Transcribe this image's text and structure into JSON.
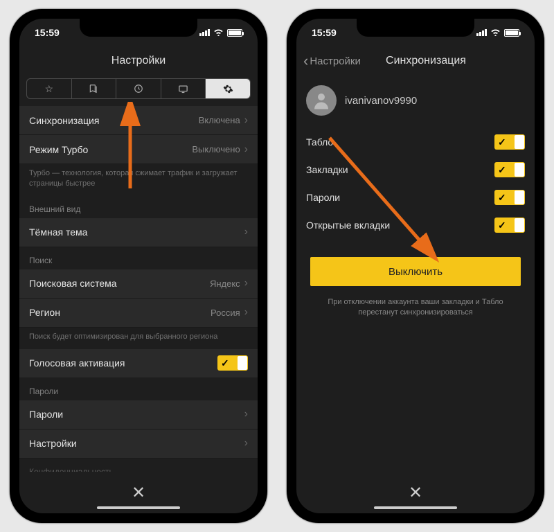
{
  "status": {
    "time": "15:59"
  },
  "left": {
    "title": "Настройки",
    "rows": {
      "sync": {
        "label": "Синхронизация",
        "value": "Включена"
      },
      "turbo": {
        "label": "Режим Турбо",
        "value": "Выключено"
      },
      "turbo_hint": "Турбо — технология, которая сжимает трафик и загружает страницы быстрее",
      "theme": {
        "label": "Тёмная тема"
      },
      "search_engine": {
        "label": "Поисковая система",
        "value": "Яндекс"
      },
      "region": {
        "label": "Регион",
        "value": "Россия"
      },
      "region_hint": "Поиск будет оптимизирован для выбранного региона",
      "voice": {
        "label": "Голосовая активация"
      },
      "passwords": {
        "label": "Пароли"
      },
      "settings": {
        "label": "Настройки"
      },
      "privacy": {
        "label": "Конфиденциальность"
      }
    },
    "sections": {
      "appearance": "Внешний вид",
      "search": "Поиск",
      "passwords": "Пароли"
    }
  },
  "right": {
    "back": "Настройки",
    "title": "Синхронизация",
    "username": "ivanivanov9990",
    "items": {
      "tablo": "Табло",
      "bookmarks": "Закладки",
      "passwords": "Пароли",
      "tabs": "Открытые вкладки"
    },
    "button": "Выключить",
    "note": "При отключении аккаунта ваши закладки и Табло перестанут синхронизироваться"
  }
}
